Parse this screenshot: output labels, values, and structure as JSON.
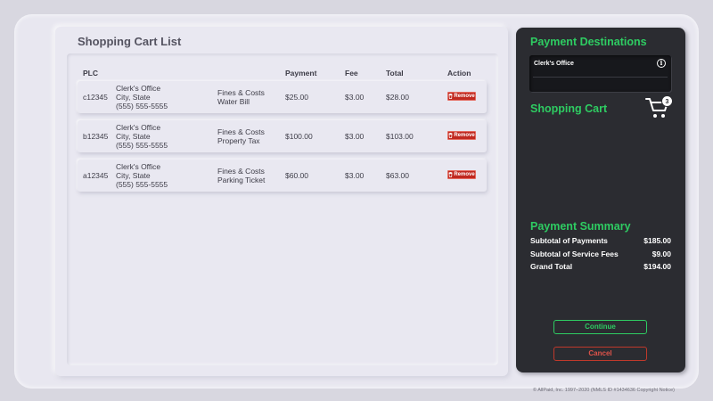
{
  "cart": {
    "title": "Shopping Cart List",
    "columns": {
      "plc": "PLC",
      "payment": "Payment",
      "fee": "Fee",
      "total": "Total",
      "action": "Action"
    },
    "rows": [
      {
        "plc": "c12345",
        "office": "Clerk's Office",
        "city": "City, State",
        "phone": "(555) 555-5555",
        "category": "Fines & Costs",
        "item": "Water Bill",
        "payment": "$25.00",
        "fee": "$3.00",
        "total": "$28.00",
        "action": "Remove"
      },
      {
        "plc": "b12345",
        "office": "Clerk's Office",
        "city": "City, State",
        "phone": "(555) 555-5555",
        "category": "Fines & Costs",
        "item": "Property Tax",
        "payment": "$100.00",
        "fee": "$3.00",
        "total": "$103.00",
        "action": "Remove"
      },
      {
        "plc": "a12345",
        "office": "Clerk's Office",
        "city": "City, State",
        "phone": "(555) 555-5555",
        "category": "Fines & Costs",
        "item": "Parking Ticket",
        "payment": "$60.00",
        "fee": "$3.00",
        "total": "$63.00",
        "action": "Remove"
      }
    ]
  },
  "sidebar": {
    "destinations_title": "Payment Destinations",
    "destination": "Clerk's Office",
    "shopping_cart_title": "Shopping Cart",
    "cart_count": "3",
    "summary_title": "Payment Summary",
    "summary": [
      {
        "label": "Subtotal of Payments",
        "value": "$185.00"
      },
      {
        "label": "Subtotal of Service Fees",
        "value": "$9.00"
      },
      {
        "label": "Grand Total",
        "value": "$194.00"
      }
    ],
    "continue_label": "Continue",
    "cancel_label": "Cancel"
  },
  "footer": "© AllPaid, Inc. 1997–2020 (NMLS ID #1434636 Copyright Notice)",
  "colors": {
    "accent_green": "#2ecc62",
    "remove_red": "#c0281f",
    "sidebar_bg": "#2b2c31"
  },
  "icons": {
    "remove": "trash-icon",
    "info": "info-icon",
    "cart": "cart-icon"
  }
}
